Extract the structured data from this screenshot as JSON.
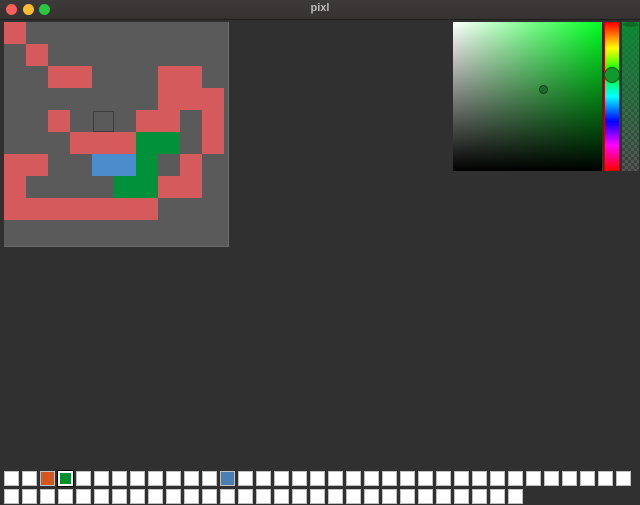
{
  "window": {
    "title": "pixl"
  },
  "canvas": {
    "background_color": "#5a5a5a",
    "grid_size": 10,
    "colors": {
      "red": "#d45a5c",
      "blue": "#4a8ccc",
      "green": "#00913a"
    },
    "pixels": [
      [
        0,
        0,
        "red"
      ],
      [
        1,
        1,
        "red"
      ],
      [
        2,
        2,
        "red"
      ],
      [
        3,
        2,
        "red"
      ],
      [
        7,
        2,
        "red"
      ],
      [
        8,
        2,
        "red"
      ],
      [
        7,
        3,
        "red"
      ],
      [
        8,
        3,
        "red"
      ],
      [
        9,
        3,
        "red"
      ],
      [
        2,
        4,
        "red"
      ],
      [
        6,
        4,
        "red"
      ],
      [
        7,
        4,
        "red"
      ],
      [
        9,
        4,
        "red"
      ],
      [
        3,
        5,
        "red"
      ],
      [
        4,
        5,
        "red"
      ],
      [
        5,
        5,
        "red"
      ],
      [
        6,
        5,
        "green"
      ],
      [
        7,
        5,
        "green"
      ],
      [
        9,
        5,
        "red"
      ],
      [
        0,
        6,
        "red"
      ],
      [
        1,
        6,
        "red"
      ],
      [
        4,
        6,
        "blue"
      ],
      [
        5,
        6,
        "blue"
      ],
      [
        6,
        6,
        "green"
      ],
      [
        8,
        6,
        "red"
      ],
      [
        0,
        7,
        "red"
      ],
      [
        5,
        7,
        "green"
      ],
      [
        6,
        7,
        "green"
      ],
      [
        7,
        7,
        "red"
      ],
      [
        8,
        7,
        "red"
      ],
      [
        0,
        8,
        "red"
      ],
      [
        1,
        8,
        "red"
      ],
      [
        2,
        8,
        "red"
      ],
      [
        3,
        8,
        "red"
      ],
      [
        4,
        8,
        "red"
      ],
      [
        5,
        8,
        "red"
      ],
      [
        6,
        8,
        "red"
      ]
    ]
  },
  "color_picker": {
    "hue_color": "#00ff22",
    "selected_color": "#1b6b2a",
    "alpha_color": "#009432"
  },
  "palette": {
    "row1": [
      "#ffffff",
      "#ffffff",
      "#d4581e",
      "#008f2f",
      "#ffffff",
      "#ffffff",
      "#ffffff",
      "#ffffff",
      "#ffffff",
      "#ffffff",
      "#ffffff",
      "#ffffff",
      "#4a7fb5",
      "#ffffff",
      "#ffffff",
      "#ffffff",
      "#ffffff",
      "#ffffff",
      "#ffffff",
      "#ffffff",
      "#ffffff",
      "#ffffff",
      "#ffffff",
      "#ffffff",
      "#ffffff",
      "#ffffff",
      "#ffffff",
      "#ffffff",
      "#ffffff",
      "#ffffff",
      "#ffffff",
      "#ffffff",
      "#ffffff",
      "#ffffff",
      "#ffffff"
    ],
    "row2": [
      "#ffffff",
      "#ffffff",
      "#ffffff",
      "#ffffff",
      "#ffffff",
      "#ffffff",
      "#ffffff",
      "#ffffff",
      "#ffffff",
      "#ffffff",
      "#ffffff",
      "#ffffff",
      "#ffffff",
      "#ffffff",
      "#ffffff",
      "#ffffff",
      "#ffffff",
      "#ffffff",
      "#ffffff",
      "#ffffff",
      "#ffffff",
      "#ffffff",
      "#ffffff",
      "#ffffff",
      "#ffffff",
      "#ffffff",
      "#ffffff",
      "#ffffff",
      "#ffffff"
    ],
    "selected_index": 3
  }
}
